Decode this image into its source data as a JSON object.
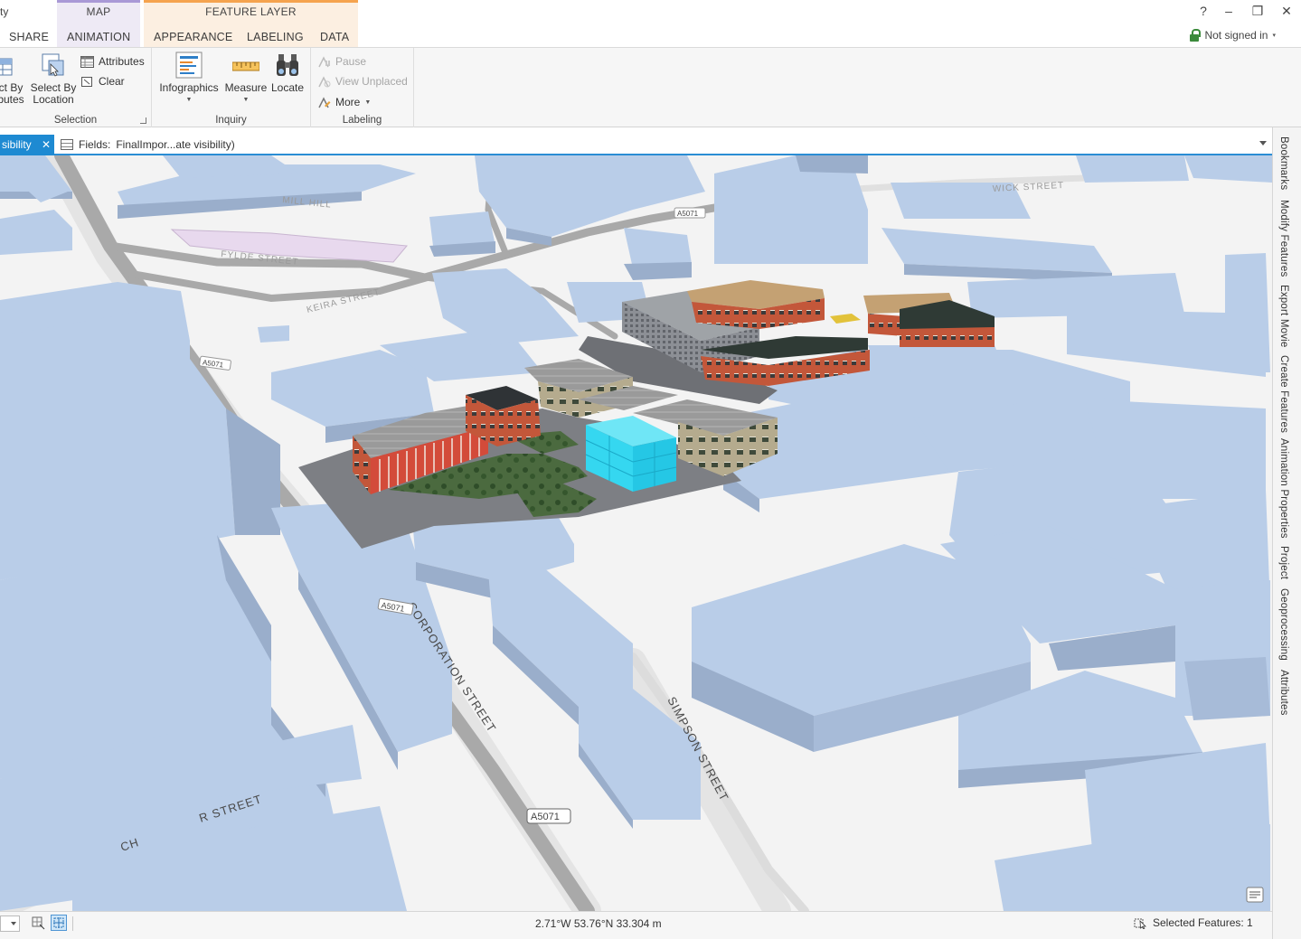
{
  "app": {
    "title_fragment": "ty"
  },
  "contextual_tabs": [
    {
      "title": "MAP",
      "tabs": [
        "ANIMATION"
      ]
    },
    {
      "title": "FEATURE LAYER",
      "tabs": [
        "APPEARANCE",
        "LABELING",
        "DATA"
      ]
    }
  ],
  "tabs": {
    "share": "SHARE",
    "animation": "ANIMATION",
    "appearance": "APPEARANCE",
    "labeling": "LABELING",
    "data": "DATA"
  },
  "window": {
    "help": "?",
    "minimize": "–",
    "restore": "❐",
    "close": "✕",
    "sign_in": "Not signed in",
    "sign_in_caret": "▾"
  },
  "ribbon": {
    "selection": {
      "label": "Selection",
      "select_by_attributes": [
        "ct By",
        "butes"
      ],
      "select_by_location": [
        "Select By",
        "Location"
      ],
      "attributes": "Attributes",
      "clear": "Clear"
    },
    "inquiry": {
      "label": "Inquiry",
      "infographics": "Infographics",
      "measure": "Measure",
      "locate": "Locate"
    },
    "labeling": {
      "label": "Labeling",
      "pause": "Pause",
      "view_unplaced": "View Unplaced",
      "more": "More"
    }
  },
  "view_tab": {
    "label": "sibility",
    "close": "✕"
  },
  "fields_bar": {
    "label": "Fields:",
    "value": "FinalImpor...ate visibility)"
  },
  "map": {
    "street_labels": [
      "CORPORATION STREET",
      "SIMPSON STREET",
      "R STREET",
      "CH",
      "KEIRA STREET",
      "FYLDE STREET",
      "MILL HILL",
      "WICK STREET"
    ],
    "road_shields": [
      "A5071",
      "A5071",
      "A5071",
      "A5071"
    ],
    "colors": {
      "building": "#b9cde8",
      "building_side": "#9aaecb",
      "road": "#a7a7a7",
      "ground": "#f3f3f3",
      "selected": "#35d7f0",
      "brick": "#c3573a"
    }
  },
  "dock": [
    "Bookmarks",
    "Modify Features",
    "Export Movie",
    "Create Features",
    "Animation Properties",
    "Project",
    "Geoprocessing",
    "Attributes"
  ],
  "status": {
    "coordinates": "2.71°W 53.76°N  33.304 m",
    "selected_features": "Selected Features: 1"
  }
}
